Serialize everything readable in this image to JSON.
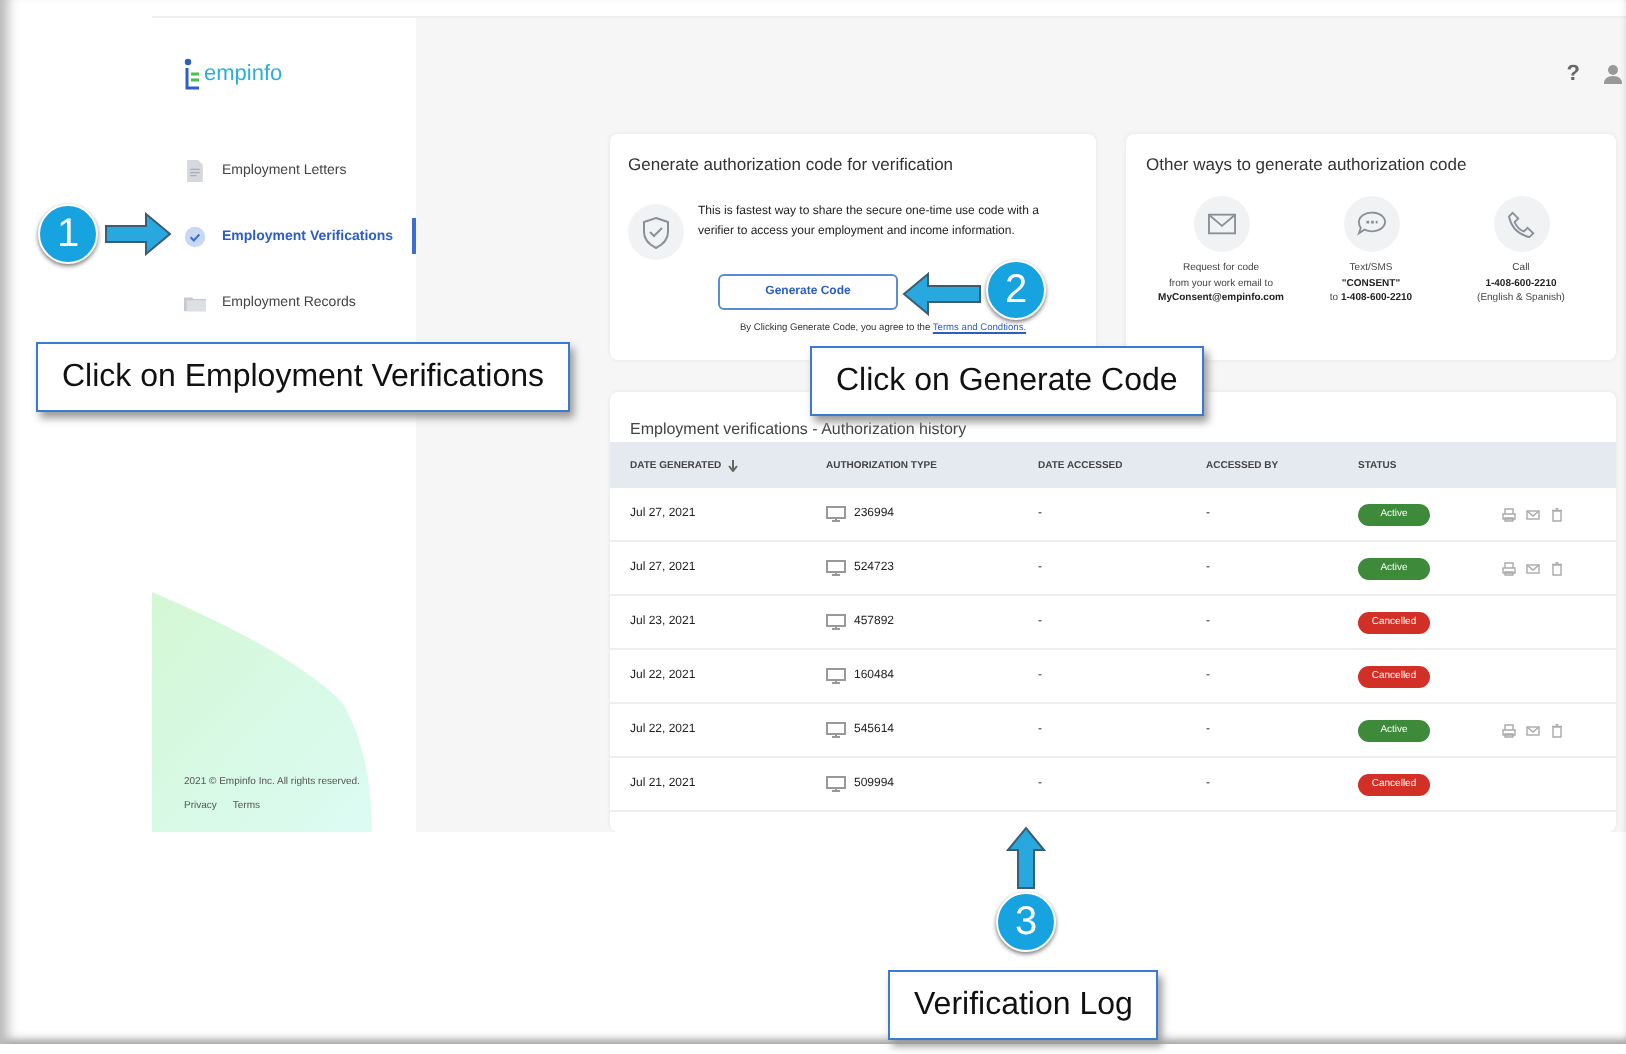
{
  "sidebar": {
    "logo": "empinfo",
    "items": [
      {
        "label": "Employment Letters",
        "kind": "document",
        "selected": false
      },
      {
        "label": "Employment Verifications",
        "kind": "check",
        "selected": true
      },
      {
        "label": "Employment Records",
        "kind": "folder",
        "selected": false
      }
    ],
    "footer": {
      "copyright": "2021 © Empinfo Inc. All rights reserved.",
      "links": [
        "Privacy",
        "Terms"
      ]
    }
  },
  "header": {
    "help": "?"
  },
  "generate_card": {
    "title": "Generate authorization code for verification",
    "description": "This is fastest way to share the secure one-time use code with a verifier to access your employment and income information.",
    "button": "Generate Code",
    "terms_prefix": "By Clicking Generate Code, you agree to the",
    "terms_link": "Terms and Condtions."
  },
  "other_ways": {
    "title": "Other ways to generate authorization code",
    "methods": [
      {
        "kind": "mail",
        "lines": [
          "Request for code",
          "from your work email to",
          "**MyConsent@empinfo.com**"
        ]
      },
      {
        "kind": "sms",
        "lines": [
          "Text/SMS",
          "**\"CONSENT\"**",
          "to **1-408-600-2210**"
        ]
      },
      {
        "kind": "phone",
        "lines": [
          "Call",
          "**1-408-600-2210**",
          "(English & Spanish)"
        ]
      }
    ]
  },
  "history": {
    "title": "Employment verifications - Authorization history",
    "columns": [
      "DATE GENERATED",
      "AUTHORIZATION TYPE",
      "DATE ACCESSED",
      "ACCESSED BY",
      "STATUS"
    ],
    "rows": [
      {
        "date": "Jul 27, 2021",
        "code": "236994",
        "accessed": "-",
        "by": "-",
        "status": "Active",
        "kind": "active",
        "actions": true
      },
      {
        "date": "Jul 27, 2021",
        "code": "524723",
        "accessed": "-",
        "by": "-",
        "status": "Active",
        "kind": "active",
        "actions": true
      },
      {
        "date": "Jul 23, 2021",
        "code": "457892",
        "accessed": "-",
        "by": "-",
        "status": "Cancelled",
        "kind": "cancelled",
        "actions": false
      },
      {
        "date": "Jul 22, 2021",
        "code": "160484",
        "accessed": "-",
        "by": "-",
        "status": "Cancelled",
        "kind": "cancelled",
        "actions": false
      },
      {
        "date": "Jul 22, 2021",
        "code": "545614",
        "accessed": "-",
        "by": "-",
        "status": "Active",
        "kind": "active",
        "actions": true
      },
      {
        "date": "Jul 21, 2021",
        "code": "509994",
        "accessed": "-",
        "by": "-",
        "status": "Cancelled",
        "kind": "cancelled",
        "actions": false
      }
    ]
  },
  "annotations": [
    {
      "number": "1",
      "label": "Click on Employment Verifications"
    },
    {
      "number": "2",
      "label": "Click on Generate Code"
    },
    {
      "number": "3",
      "label": "Verification Log"
    }
  ]
}
